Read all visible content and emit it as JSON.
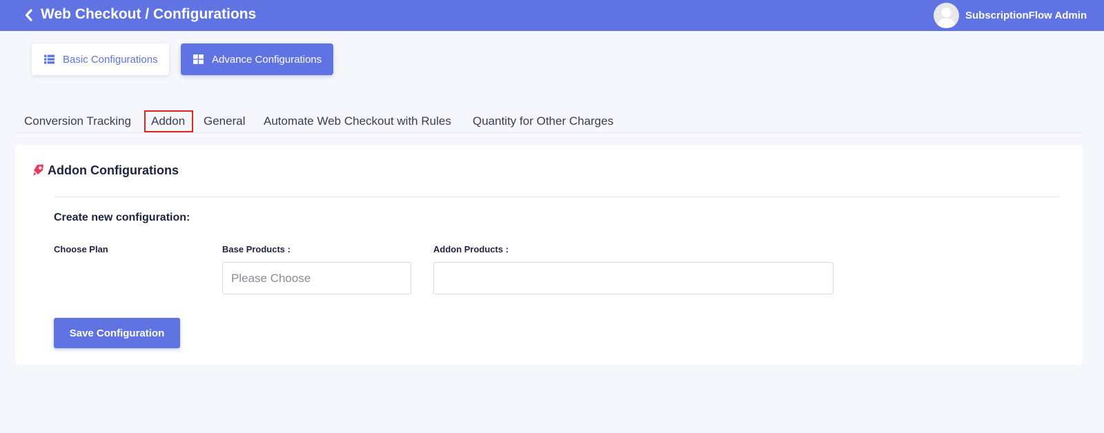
{
  "header": {
    "title": "Web Checkout / Configurations",
    "back_icon": "chevron-left-icon",
    "user_name": "SubscriptionFlow Admin",
    "avatar_icon": "user-avatar-icon",
    "color": "#5f73e3"
  },
  "config_buttons": {
    "basic_label": "Basic Configurations",
    "basic_icon": "list-icon",
    "advance_label": "Advance Configurations",
    "advance_icon": "grid-icon",
    "active": "advance"
  },
  "tabs": [
    {
      "label": "Conversion Tracking"
    },
    {
      "label": "Addon",
      "active": true
    },
    {
      "label": "General"
    },
    {
      "label": "Automate Web Checkout with Rules"
    },
    {
      "label": "Quantity for Other Charges"
    }
  ],
  "card": {
    "title": "Addon Configurations",
    "title_icon": "addon-icon",
    "section_heading": "Create new configuration:",
    "choose_plan_label": "Choose Plan",
    "base_products_label": "Base Products :",
    "base_products_placeholder": "Please Choose",
    "addon_products_label": "Addon Products :",
    "addon_products_value": "",
    "save_label": "Save Configuration"
  },
  "colors": {
    "accent": "#5f73e3",
    "active_tab_outline": "#e0261e",
    "background": "#f6f7fc"
  }
}
